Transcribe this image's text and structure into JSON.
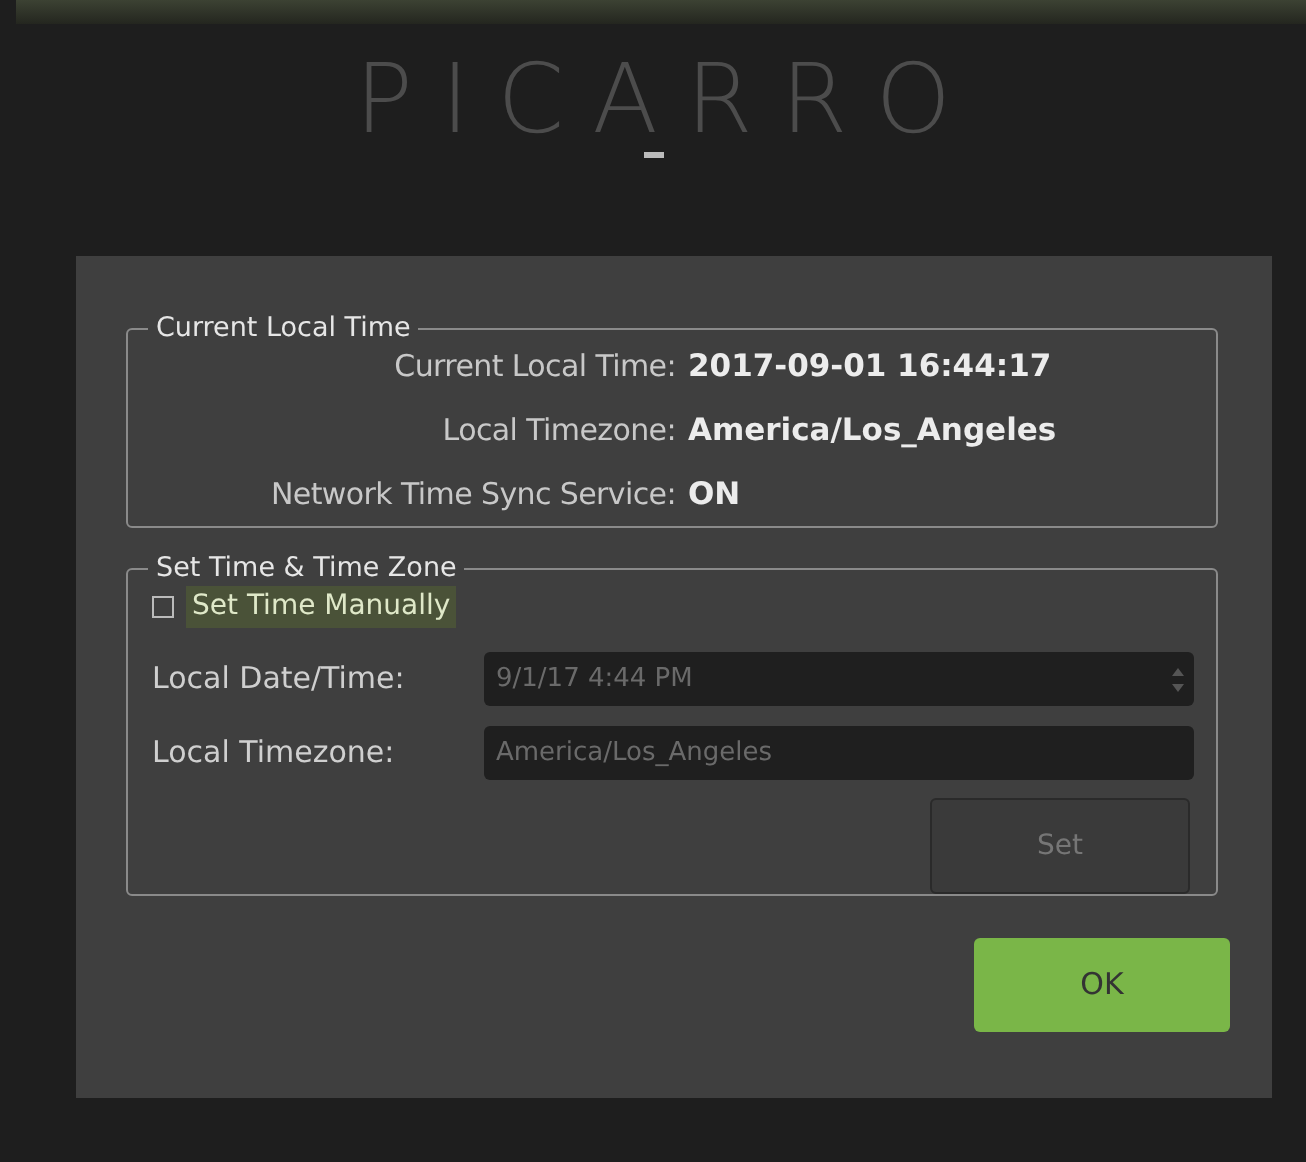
{
  "logo": "PICARRO",
  "dialog": {
    "current_group": {
      "title": "Current Local Time",
      "rows": [
        {
          "label": "Current Local Time:",
          "value": "2017-09-01 16:44:17"
        },
        {
          "label": "Local Timezone:",
          "value": "America/Los_Angeles"
        },
        {
          "label": "Network Time Sync Service:",
          "value": "ON"
        }
      ]
    },
    "set_group": {
      "title": "Set Time & Time Zone",
      "manual_checkbox": {
        "label": "Set Time Manually",
        "checked": false,
        "focused": true
      },
      "fields": [
        {
          "label": "Local Date/Time:",
          "value": "9/1/17 4:44 PM",
          "kind": "spinner",
          "disabled": true
        },
        {
          "label": "Local Timezone:",
          "value": "America/Los_Angeles",
          "kind": "text",
          "disabled": true
        }
      ],
      "set_button": {
        "label": "Set",
        "disabled": true
      }
    },
    "ok_button": {
      "label": "OK"
    }
  }
}
